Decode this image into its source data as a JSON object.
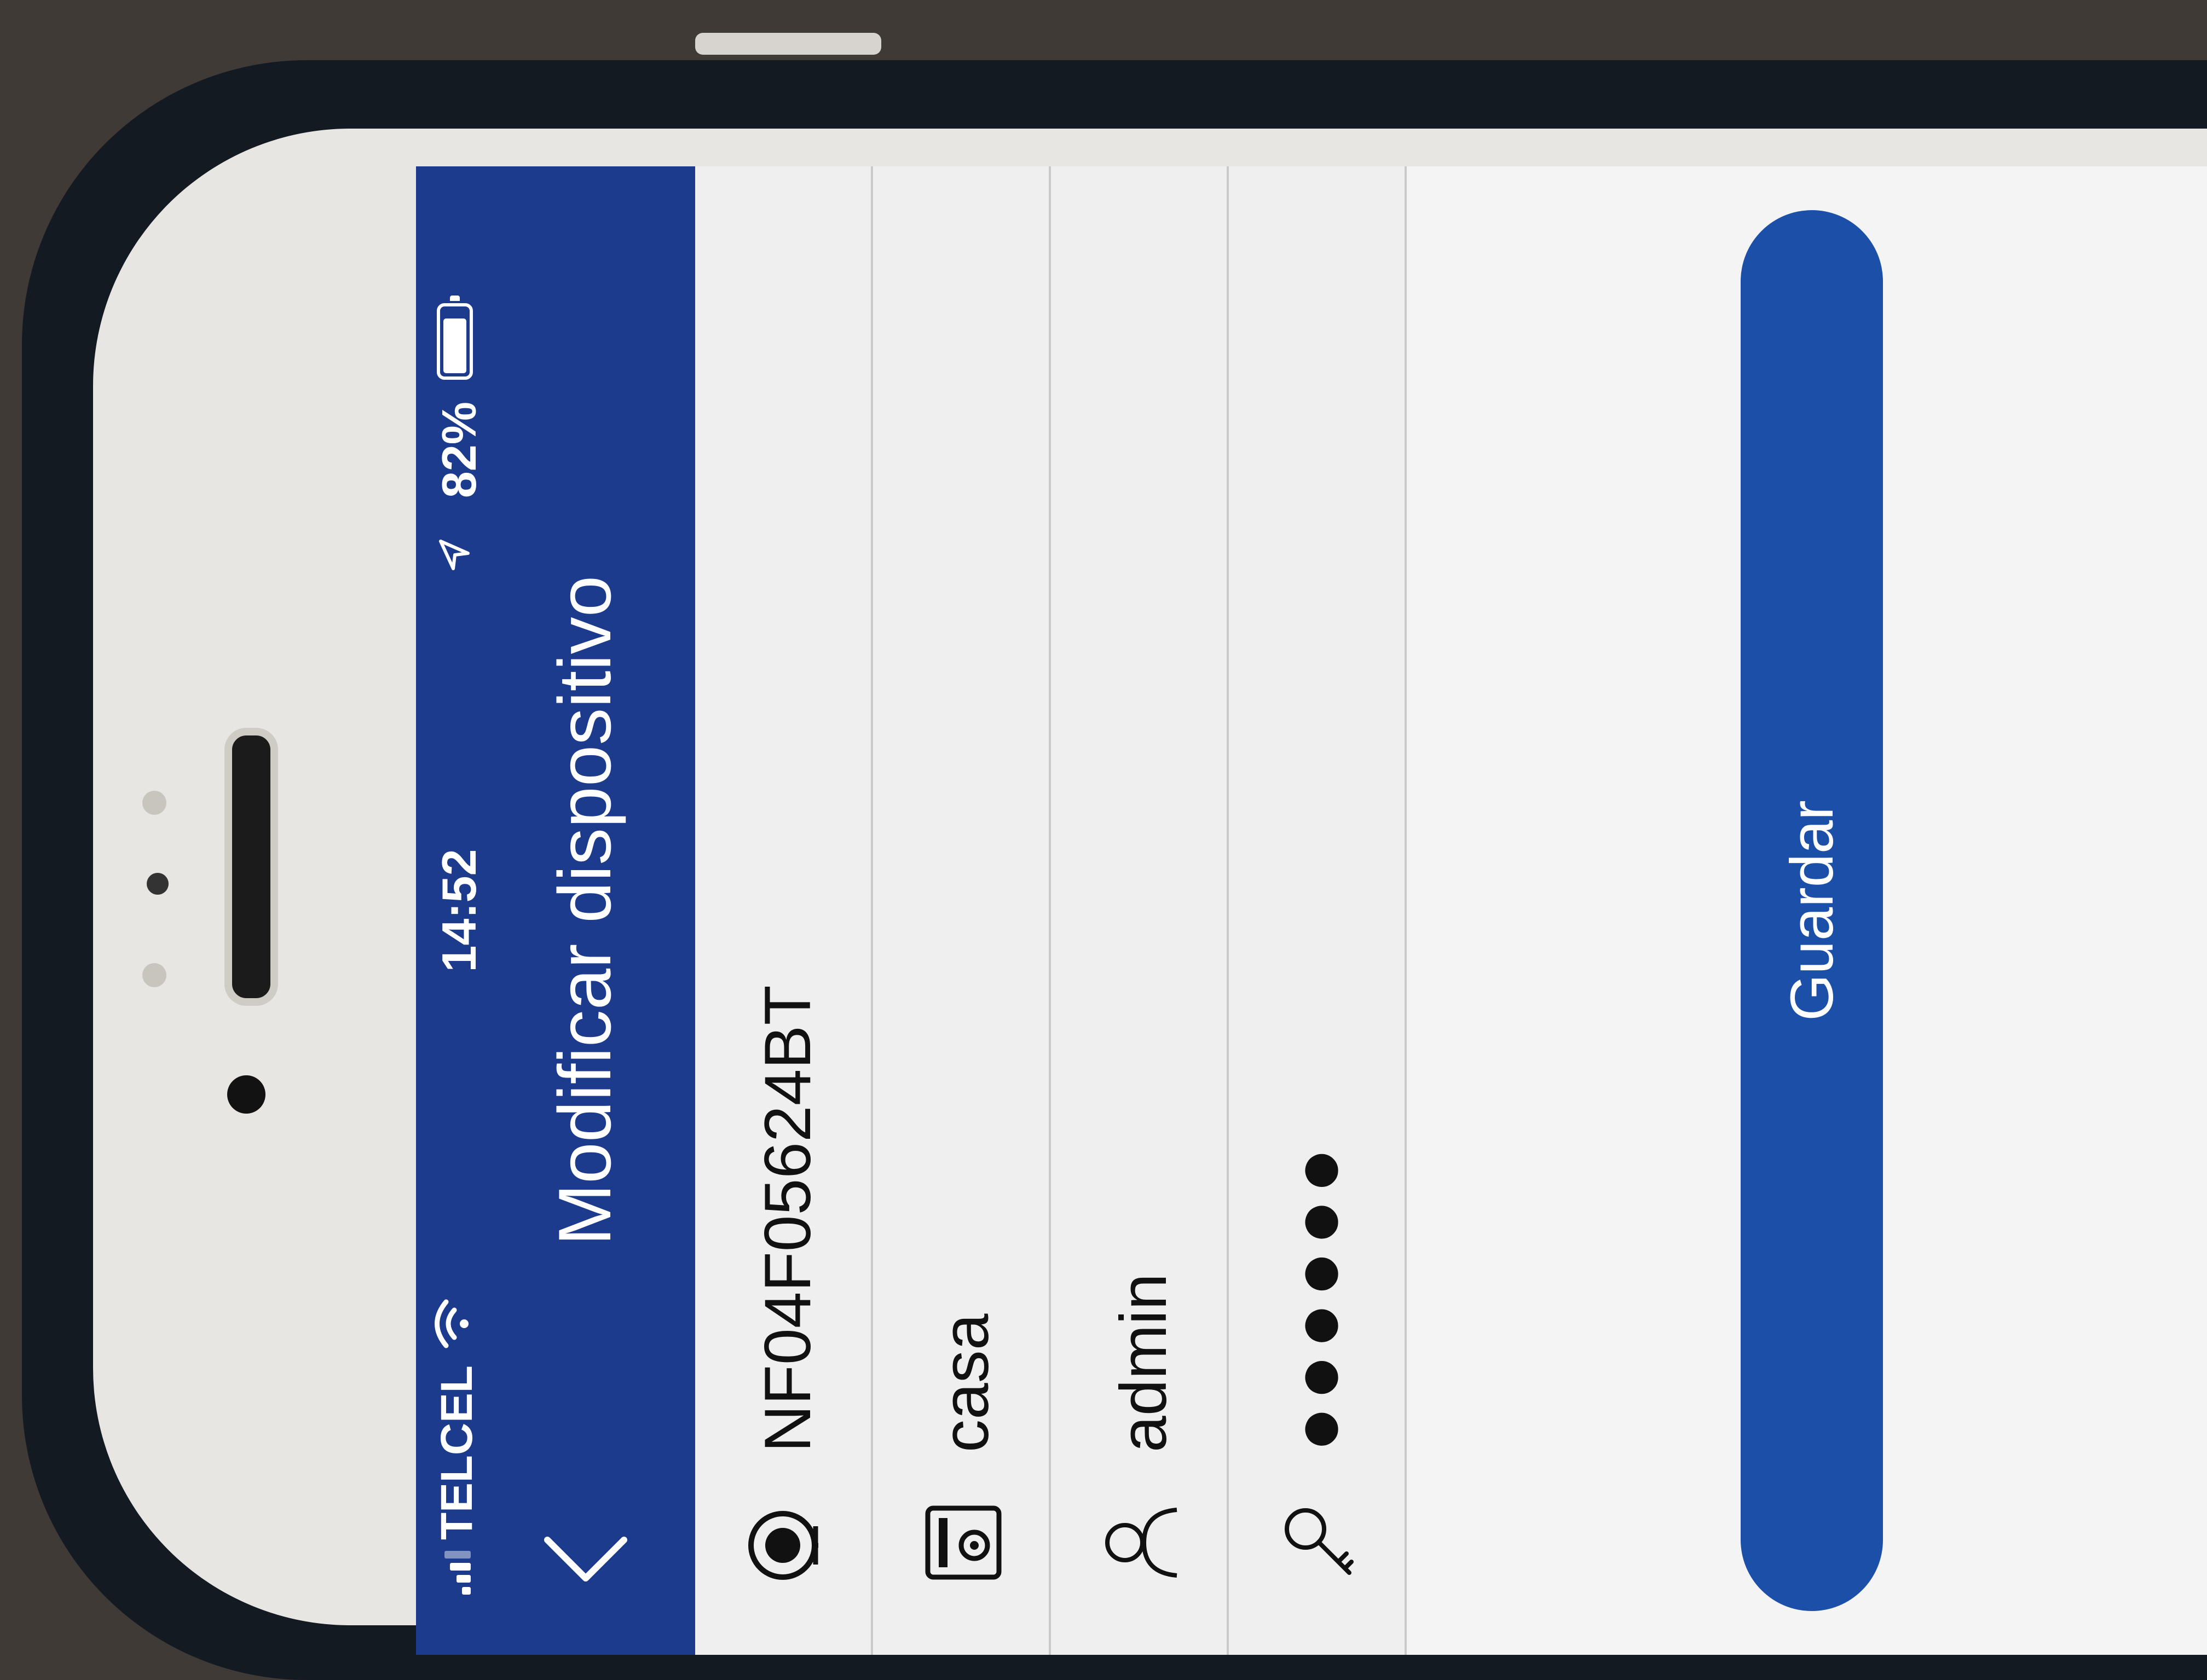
{
  "status_bar": {
    "carrier": "TELCEL",
    "time": "14:52",
    "battery": "82%",
    "battery_level": 0.82,
    "icons": [
      "signal-icon",
      "wifi-icon",
      "location-icon",
      "battery-icon"
    ]
  },
  "nav": {
    "title": "Modificar dispositivo",
    "back_icon": "chevron-left-icon"
  },
  "form": {
    "rows": [
      {
        "icon": "camera-icon",
        "value": "NF04F05624BT"
      },
      {
        "icon": "device-icon",
        "value": "casa"
      },
      {
        "icon": "user-icon",
        "value": "admin"
      },
      {
        "icon": "key-icon",
        "value": "●●●●●●"
      }
    ]
  },
  "actions": {
    "save_label": "Guardar"
  },
  "colors": {
    "header": "#1c3b8c",
    "button": "#1c4fa8",
    "rows": "#efefef"
  }
}
